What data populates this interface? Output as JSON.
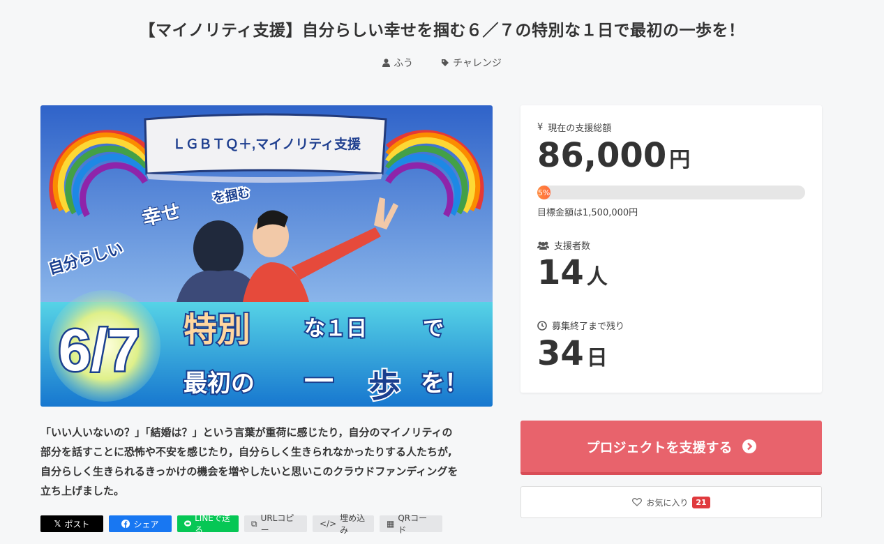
{
  "page": {
    "title": "【マイノリティ支援】自分らしい幸せを掴む６／７の特別な１日で最初の一歩を！",
    "author": "ふう",
    "category": "チャレンジ"
  },
  "hero": {
    "banner_text": "ＬＧＢＴＱ＋,マイノリティ支援",
    "line1a": "自分らしい",
    "line1b": "幸せ",
    "line1c": "を掴む",
    "date": "6/7",
    "line2a": "特別",
    "line2b": "な１日",
    "line2c": "で",
    "line3a": "最初の",
    "line3b": "一",
    "line3c": "歩",
    "line3d": "を！"
  },
  "description": [
    "「いい人いないの？」「結婚は？」という言葉が重荷に感じたり，自分のマイノリティの",
    "部分を話すことに恐怖や不安を感じたり，自分らしく生きられなかったりする人たちが,",
    "自分らしく生きられるきっかけの機会を増やしたいと思いこのクラウドファンディングを",
    "立ち上げました。"
  ],
  "share": {
    "x": "ポスト",
    "facebook": "シェア",
    "line": "LINEで送る",
    "url": "URLコピー",
    "embed": "埋め込み",
    "qr": "QRコード"
  },
  "stats": {
    "total_label": "現在の支援総額",
    "total_value": "86,000",
    "total_unit": "円",
    "progress_percent": 5,
    "progress_label": "5%",
    "goal_text": "目標金額は1,500,000円",
    "supporters_label": "支援者数",
    "supporters_value": "14",
    "supporters_unit": "人",
    "remaining_label": "募集終了まで残り",
    "remaining_value": "34",
    "remaining_unit": "日"
  },
  "cta": {
    "label": "プロジェクトを支援する"
  },
  "favorite": {
    "label": "お気に入り",
    "count": "21"
  },
  "colors": {
    "cta": "#e8636c",
    "progress": "#ff7a3d",
    "fav_badge": "#e03a3e"
  }
}
